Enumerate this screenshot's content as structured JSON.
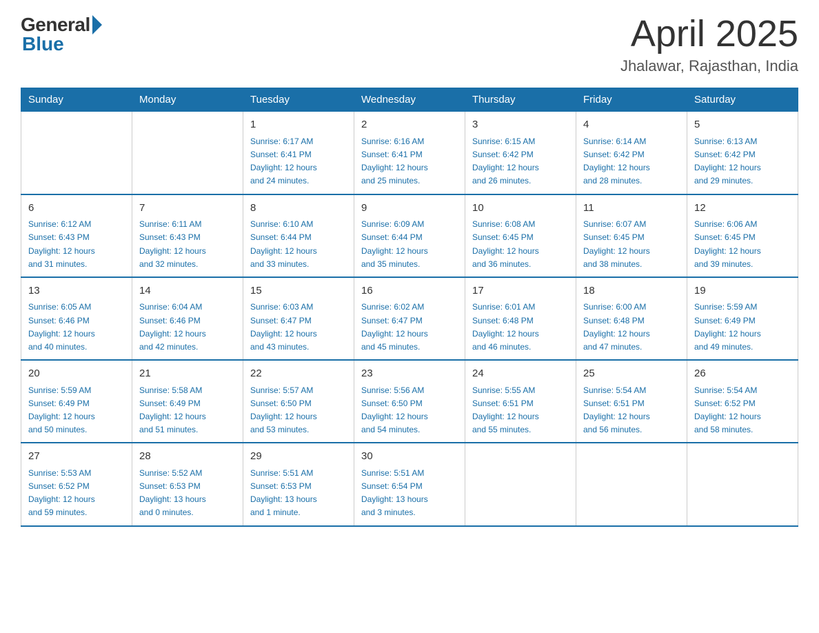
{
  "header": {
    "logo_general": "General",
    "logo_blue": "Blue",
    "title": "April 2025",
    "subtitle": "Jhalawar, Rajasthan, India"
  },
  "calendar": {
    "days_of_week": [
      "Sunday",
      "Monday",
      "Tuesday",
      "Wednesday",
      "Thursday",
      "Friday",
      "Saturday"
    ],
    "weeks": [
      [
        {
          "day": "",
          "info": ""
        },
        {
          "day": "",
          "info": ""
        },
        {
          "day": "1",
          "info": "Sunrise: 6:17 AM\nSunset: 6:41 PM\nDaylight: 12 hours\nand 24 minutes."
        },
        {
          "day": "2",
          "info": "Sunrise: 6:16 AM\nSunset: 6:41 PM\nDaylight: 12 hours\nand 25 minutes."
        },
        {
          "day": "3",
          "info": "Sunrise: 6:15 AM\nSunset: 6:42 PM\nDaylight: 12 hours\nand 26 minutes."
        },
        {
          "day": "4",
          "info": "Sunrise: 6:14 AM\nSunset: 6:42 PM\nDaylight: 12 hours\nand 28 minutes."
        },
        {
          "day": "5",
          "info": "Sunrise: 6:13 AM\nSunset: 6:42 PM\nDaylight: 12 hours\nand 29 minutes."
        }
      ],
      [
        {
          "day": "6",
          "info": "Sunrise: 6:12 AM\nSunset: 6:43 PM\nDaylight: 12 hours\nand 31 minutes."
        },
        {
          "day": "7",
          "info": "Sunrise: 6:11 AM\nSunset: 6:43 PM\nDaylight: 12 hours\nand 32 minutes."
        },
        {
          "day": "8",
          "info": "Sunrise: 6:10 AM\nSunset: 6:44 PM\nDaylight: 12 hours\nand 33 minutes."
        },
        {
          "day": "9",
          "info": "Sunrise: 6:09 AM\nSunset: 6:44 PM\nDaylight: 12 hours\nand 35 minutes."
        },
        {
          "day": "10",
          "info": "Sunrise: 6:08 AM\nSunset: 6:45 PM\nDaylight: 12 hours\nand 36 minutes."
        },
        {
          "day": "11",
          "info": "Sunrise: 6:07 AM\nSunset: 6:45 PM\nDaylight: 12 hours\nand 38 minutes."
        },
        {
          "day": "12",
          "info": "Sunrise: 6:06 AM\nSunset: 6:45 PM\nDaylight: 12 hours\nand 39 minutes."
        }
      ],
      [
        {
          "day": "13",
          "info": "Sunrise: 6:05 AM\nSunset: 6:46 PM\nDaylight: 12 hours\nand 40 minutes."
        },
        {
          "day": "14",
          "info": "Sunrise: 6:04 AM\nSunset: 6:46 PM\nDaylight: 12 hours\nand 42 minutes."
        },
        {
          "day": "15",
          "info": "Sunrise: 6:03 AM\nSunset: 6:47 PM\nDaylight: 12 hours\nand 43 minutes."
        },
        {
          "day": "16",
          "info": "Sunrise: 6:02 AM\nSunset: 6:47 PM\nDaylight: 12 hours\nand 45 minutes."
        },
        {
          "day": "17",
          "info": "Sunrise: 6:01 AM\nSunset: 6:48 PM\nDaylight: 12 hours\nand 46 minutes."
        },
        {
          "day": "18",
          "info": "Sunrise: 6:00 AM\nSunset: 6:48 PM\nDaylight: 12 hours\nand 47 minutes."
        },
        {
          "day": "19",
          "info": "Sunrise: 5:59 AM\nSunset: 6:49 PM\nDaylight: 12 hours\nand 49 minutes."
        }
      ],
      [
        {
          "day": "20",
          "info": "Sunrise: 5:59 AM\nSunset: 6:49 PM\nDaylight: 12 hours\nand 50 minutes."
        },
        {
          "day": "21",
          "info": "Sunrise: 5:58 AM\nSunset: 6:49 PM\nDaylight: 12 hours\nand 51 minutes."
        },
        {
          "day": "22",
          "info": "Sunrise: 5:57 AM\nSunset: 6:50 PM\nDaylight: 12 hours\nand 53 minutes."
        },
        {
          "day": "23",
          "info": "Sunrise: 5:56 AM\nSunset: 6:50 PM\nDaylight: 12 hours\nand 54 minutes."
        },
        {
          "day": "24",
          "info": "Sunrise: 5:55 AM\nSunset: 6:51 PM\nDaylight: 12 hours\nand 55 minutes."
        },
        {
          "day": "25",
          "info": "Sunrise: 5:54 AM\nSunset: 6:51 PM\nDaylight: 12 hours\nand 56 minutes."
        },
        {
          "day": "26",
          "info": "Sunrise: 5:54 AM\nSunset: 6:52 PM\nDaylight: 12 hours\nand 58 minutes."
        }
      ],
      [
        {
          "day": "27",
          "info": "Sunrise: 5:53 AM\nSunset: 6:52 PM\nDaylight: 12 hours\nand 59 minutes."
        },
        {
          "day": "28",
          "info": "Sunrise: 5:52 AM\nSunset: 6:53 PM\nDaylight: 13 hours\nand 0 minutes."
        },
        {
          "day": "29",
          "info": "Sunrise: 5:51 AM\nSunset: 6:53 PM\nDaylight: 13 hours\nand 1 minute."
        },
        {
          "day": "30",
          "info": "Sunrise: 5:51 AM\nSunset: 6:54 PM\nDaylight: 13 hours\nand 3 minutes."
        },
        {
          "day": "",
          "info": ""
        },
        {
          "day": "",
          "info": ""
        },
        {
          "day": "",
          "info": ""
        }
      ]
    ]
  }
}
